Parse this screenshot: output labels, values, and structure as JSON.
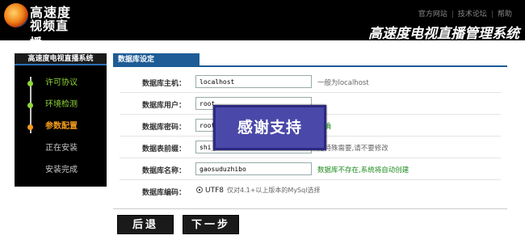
{
  "header": {
    "logo_line1": "高速度",
    "logo_line2": "视频直播",
    "links": [
      "官方网站",
      "技术论坛",
      "帮助"
    ],
    "title": "高速度电视直播管理系统"
  },
  "sidebar": {
    "title": "高速度电视直播系统",
    "steps": [
      {
        "label": "许可协议",
        "state": "done"
      },
      {
        "label": "环境检测",
        "state": "done"
      },
      {
        "label": "参数配置",
        "state": "active"
      },
      {
        "label": "正在安装",
        "state": "pending"
      },
      {
        "label": "安装完成",
        "state": "pending"
      }
    ]
  },
  "panel": {
    "tab_label": "数据库设定",
    "fields": [
      {
        "label": "数据库主机：",
        "value": "localhost",
        "note": "一般为localhost"
      },
      {
        "label": "数据库用户：",
        "value": "root",
        "note": ""
      },
      {
        "label": "数据库密码：",
        "value": "root",
        "note": "正确"
      },
      {
        "label": "数据表前缀：",
        "value": "shi_",
        "note": "无特殊需要,请不要修改"
      },
      {
        "label": "数据库名称：",
        "value": "gaosuduzhibo",
        "note": "数据库不存在,系统将自动创建"
      }
    ],
    "encoding": {
      "label": "数据库编码：",
      "option": "UTF8",
      "hint": "仅对4.1+以上版本的MySql选择"
    }
  },
  "overlay": {
    "text": "感谢支持"
  },
  "buttons": {
    "back": "后退",
    "next": "下一步"
  },
  "colors": {
    "accent_blue": "#1d5c96",
    "done_green": "#8fd63a",
    "active_orange": "#f39a1c",
    "note_green": "#1a8a1a",
    "badge_purple": "#4a48a8"
  }
}
